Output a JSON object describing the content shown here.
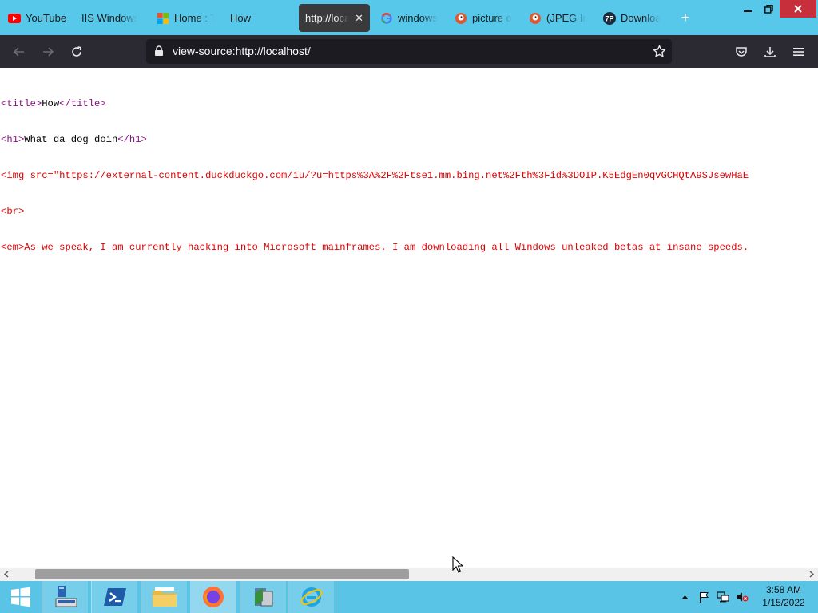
{
  "browser": {
    "tabs": [
      {
        "label": "YouTube",
        "icon": "youtube-icon"
      },
      {
        "label": "IIS Windows",
        "icon": "none"
      },
      {
        "label": "Home : T",
        "icon": "microsoft-icon"
      },
      {
        "label": "How",
        "icon": "none"
      },
      {
        "label": "http://loca",
        "icon": "none",
        "active": true
      },
      {
        "label": "windows",
        "icon": "google-icon"
      },
      {
        "label": "picture o",
        "icon": "duckduckgo-icon"
      },
      {
        "label": "(JPEG Im",
        "icon": "duckduckgo-icon"
      },
      {
        "label": "Downloa",
        "icon": "7p-icon"
      }
    ],
    "new_tab": "+",
    "url": "view-source:http://localhost/"
  },
  "source": {
    "line1": {
      "open": "<title>",
      "text": "How",
      "close": "</title>"
    },
    "line2": {
      "open": "<h1>",
      "text": "What da dog doin",
      "close": "</h1>"
    },
    "line3": "<img src=\"https://external-content.duckduckgo.com/iu/?u=https%3A%2F%2Ftse1.mm.bing.net%2Fth%3Fid%3DOIP.K5EdgEn0qvGCHQtA9SJsewHaE",
    "line4": "<br>",
    "line5": "<em>As we speak, I am currently hacking into Microsoft mainframes. I am downloading all Windows unleaked betas at insane speeds."
  },
  "taskbar": {
    "time": "3:58 AM",
    "date": "1/15/2022"
  },
  "colors": {
    "tabstrip": "#58c8ea",
    "navbar": "#2b2a33",
    "tag": "#881280",
    "error": "#e00000",
    "taskbar": "#5ac4e6"
  }
}
